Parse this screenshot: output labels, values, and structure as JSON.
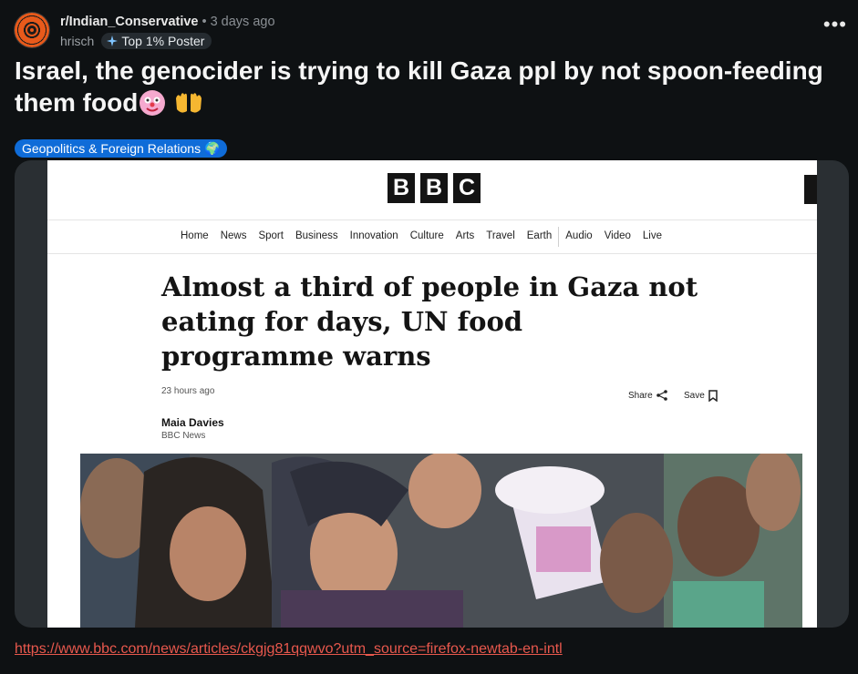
{
  "post": {
    "subreddit": "r/Indian_Conservative",
    "separator": "•",
    "time_ago": "3 days ago",
    "author": "hrisch",
    "author_flair": "Top 1% Poster",
    "more_label": "•••",
    "title": "Israel, the genocider is trying to kill Gaza ppl by not spoon-feeding them food",
    "flair": "Geopolitics & Foreign Relations 🌍",
    "link": "https://www.bbc.com/news/articles/ckgjg81qqwvo?utm_source=firefox-newtab-en-intl"
  },
  "article": {
    "logo_letters": [
      "B",
      "B",
      "C"
    ],
    "nav_items": [
      "Home",
      "News",
      "Sport",
      "Business",
      "Innovation",
      "Culture",
      "Arts",
      "Travel",
      "Earth"
    ],
    "nav_items_after_sep": [
      "Audio",
      "Video",
      "Live"
    ],
    "headline": "Almost a third of people in Gaza not eating for days, UN food programme warns",
    "timestamp": "23 hours ago",
    "share_label": "Share",
    "save_label": "Save",
    "author": "Maia Davies",
    "outlet": "BBC News"
  },
  "colors": {
    "background": "#0e1113",
    "flair_bg": "#0f6cd8",
    "link": "#e8584d",
    "subreddit_icon": "#e85a1b"
  }
}
